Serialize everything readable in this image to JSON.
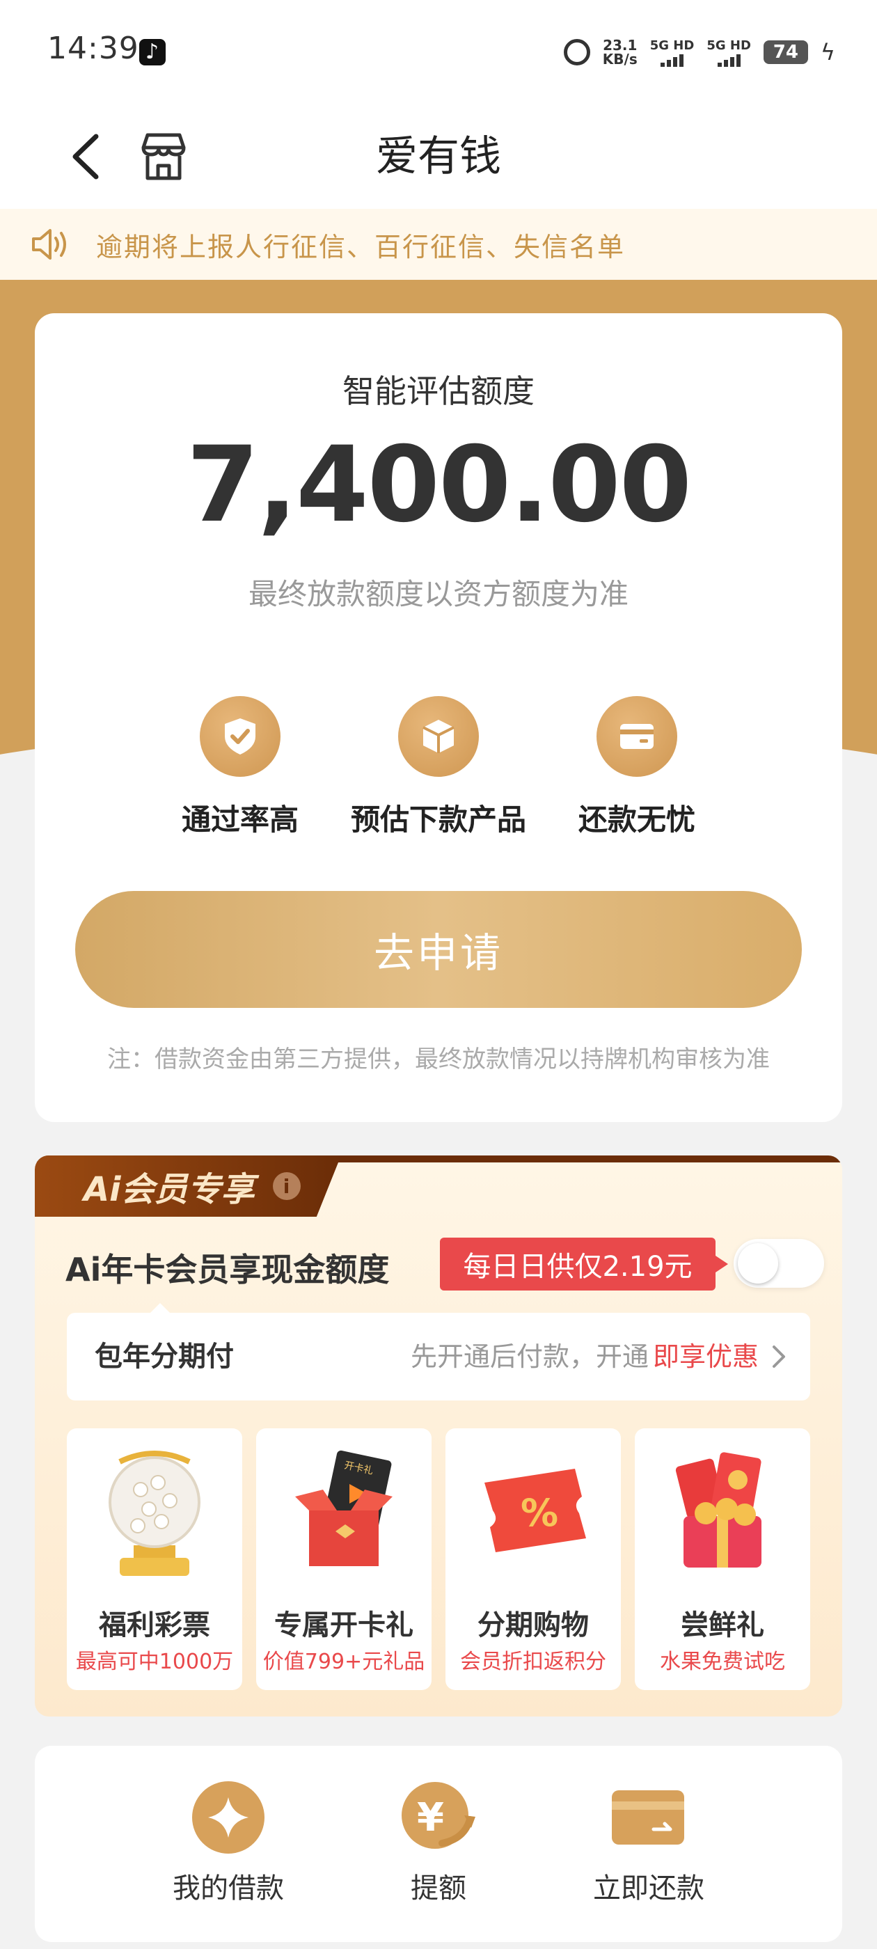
{
  "status_bar": {
    "time": "14:39",
    "net_speed_value": "23.1",
    "net_speed_unit": "KB/s",
    "sim1": "5G HD",
    "sim2": "5G HD",
    "battery": "74"
  },
  "nav": {
    "title": "爱有钱"
  },
  "notice": {
    "text": "逾期将上报人行征信、百行征信、失信名单"
  },
  "credit_card": {
    "label": "智能评估额度",
    "amount": "7,400.00",
    "subtitle": "最终放款额度以资方额度为准",
    "features": [
      {
        "label": "通过率高",
        "icon": "shield-check-icon"
      },
      {
        "label": "预估下款产品",
        "icon": "box-icon"
      },
      {
        "label": "还款无忧",
        "icon": "card-icon"
      }
    ],
    "apply_label": "去申请",
    "note": "注：借款资金由第三方提供，最终放款情况以持牌机构审核为准"
  },
  "member": {
    "tab_label": "Ai会员专享",
    "info_icon": "i",
    "title": "Ai年卡会员享现金额度",
    "price_badge": "每日日供仅2.19元",
    "toggle_on": false,
    "plan_label": "包年分期付",
    "plan_desc": "先开通后付款，开通",
    "plan_highlight": "即享优惠",
    "benefits": [
      {
        "name": "福利彩票",
        "desc": "最高可中1000万",
        "icon": "lottery-ball-icon"
      },
      {
        "name": "专属开卡礼",
        "desc": "价值799+元礼品",
        "icon": "gift-box-icon",
        "badge": "开卡礼"
      },
      {
        "name": "分期购物",
        "desc": "会员折扣返积分",
        "icon": "discount-ticket-icon"
      },
      {
        "name": "尝鲜礼",
        "desc": "水果免费试吃",
        "icon": "red-envelope-gift-icon"
      }
    ]
  },
  "actions": [
    {
      "label": "我的借款",
      "icon": "diamond-icon"
    },
    {
      "label": "提额",
      "icon": "yen-up-icon"
    },
    {
      "label": "立即还款",
      "icon": "repay-card-icon"
    }
  ],
  "colors": {
    "gold": "#d1a05a",
    "red": "#e9494b",
    "notice_text": "#c8954a"
  }
}
